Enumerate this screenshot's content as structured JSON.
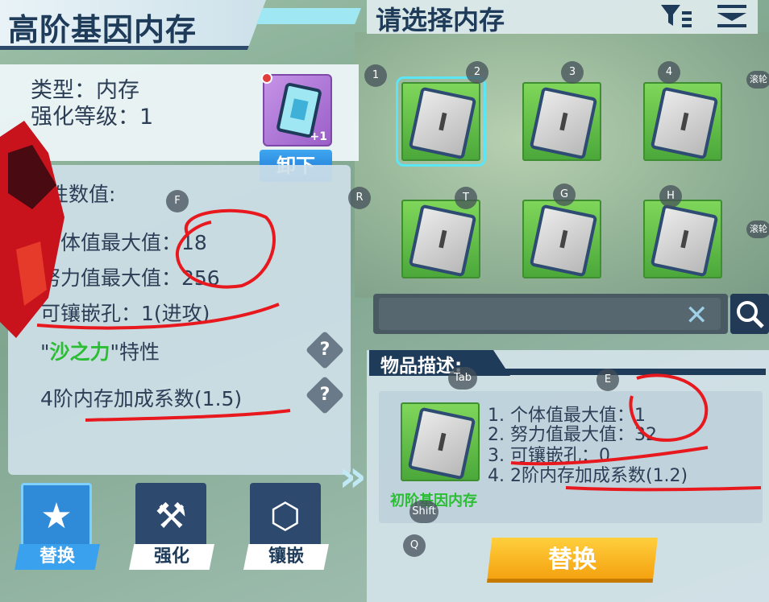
{
  "left": {
    "title": "高阶基因内存",
    "type_label": "类型：内存",
    "level_label": "强化等级：1",
    "item_badge": "+1",
    "unload_label": "卸下",
    "stats_title": "性数值:",
    "stats": [
      "个体值最大值：18",
      "努力值最大值：256",
      "可镶嵌孔：1(进攻)"
    ],
    "trait_prefix": "\"",
    "trait_name": "沙之力",
    "trait_suffix": "\"特性",
    "bonus_line": "4阶内存加成系数(1.5)",
    "help_glyph": "?",
    "tabs": [
      {
        "label": "替换",
        "icon": "shield-star-icon"
      },
      {
        "label": "强化",
        "icon": "hammer-anvil-icon"
      },
      {
        "label": "镶嵌",
        "icon": "gem-socket-icon"
      }
    ]
  },
  "right": {
    "title": "请选择内存",
    "slot_glyph": "I",
    "desc_header": "物品描述:",
    "desc_item_name": "初阶基因内存",
    "desc_lines": [
      "1. 个体值最大值：1",
      "2. 努力值最大值：32",
      "3. 可镶嵌孔：0",
      "4. 2阶内存加成系数(1.2)"
    ],
    "replace_label": "替换",
    "search_placeholder": "",
    "clear_glyph": "✕"
  },
  "key_hints": {
    "k1": "1",
    "k2": "2",
    "k3": "3",
    "k4": "4",
    "kR": "R",
    "kT": "T",
    "kG": "G",
    "kH": "H",
    "kF": "F",
    "kE": "E",
    "kTab": "Tab",
    "kShift": "Shift",
    "kQ": "Q",
    "scroll1": "滚轮",
    "scroll2": "滚轮"
  },
  "colors": {
    "accent_green": "#2bbd33",
    "primary_blue": "#1f3b5a",
    "replace_yellow": "#f5a210",
    "annotation_red": "#e8191e"
  }
}
